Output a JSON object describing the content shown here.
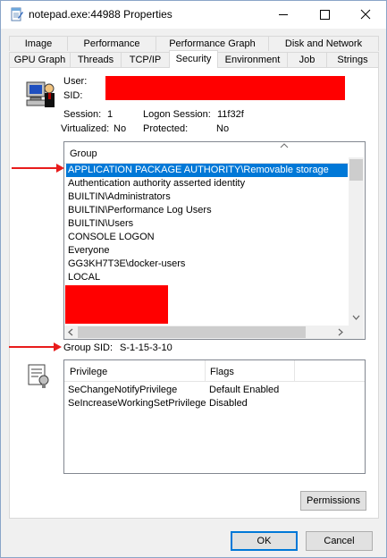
{
  "window": {
    "title": "notepad.exe:44988 Properties"
  },
  "colors": {
    "accent": "#0078d7",
    "redaction": "#ff0000",
    "annotation_arrow": "#e81c1c"
  },
  "tabs_row1": [
    {
      "label": "Image"
    },
    {
      "label": "Performance"
    },
    {
      "label": "Performance Graph"
    },
    {
      "label": "Disk and Network"
    }
  ],
  "tabs_row2": [
    {
      "label": "GPU Graph"
    },
    {
      "label": "Threads"
    },
    {
      "label": "TCP/IP"
    },
    {
      "label": "Security",
      "selected": true
    },
    {
      "label": "Environment"
    },
    {
      "label": "Job"
    },
    {
      "label": "Strings"
    }
  ],
  "token": {
    "user_label": "User:",
    "sid_label": "SID:",
    "session_label": "Session:",
    "session_value": "1",
    "logon_session_label": "Logon Session:",
    "logon_session_value": "11f32f",
    "virtualized_label": "Virtualized:",
    "virtualized_value": "No",
    "protected_label": "Protected:",
    "protected_value": "No"
  },
  "groups": {
    "header": "Group",
    "items": [
      "APPLICATION PACKAGE AUTHORITY\\Removable storage",
      "Authentication authority asserted identity",
      "BUILTIN\\Administrators",
      "BUILTIN\\Performance Log Users",
      "BUILTIN\\Users",
      "CONSOLE LOGON",
      "Everyone",
      "GG3KH7T3E\\docker-users",
      "LOCAL"
    ],
    "selected_index": 0,
    "group_sid_label": "Group SID:",
    "group_sid_value": "S-1-15-3-10"
  },
  "privileges": {
    "header_privilege": "Privilege",
    "header_flags": "Flags",
    "rows": [
      {
        "privilege": "SeChangeNotifyPrivilege",
        "flags": "Default Enabled"
      },
      {
        "privilege": "SeIncreaseWorkingSetPrivilege",
        "flags": "Disabled"
      }
    ]
  },
  "buttons": {
    "permissions": "Permissions",
    "ok": "OK",
    "cancel": "Cancel"
  }
}
